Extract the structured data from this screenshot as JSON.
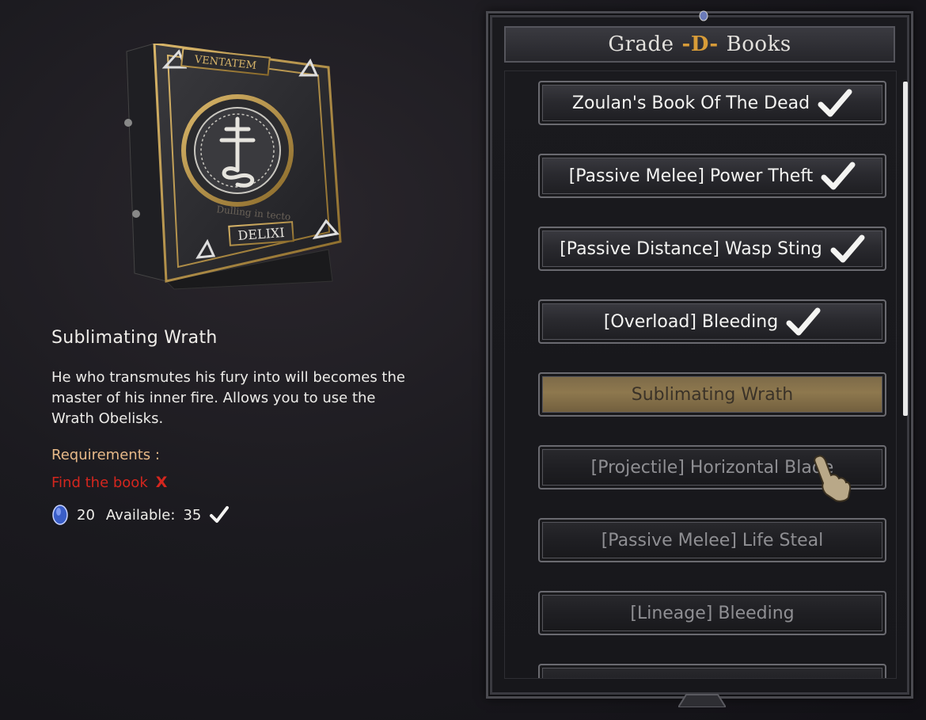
{
  "detail": {
    "title": "Sublimating Wrath",
    "description": "He who transmutes his fury into will becomes the master of his inner fire. Allows you to use the Wrath Obelisks.",
    "requirements_label": "Requirements :",
    "find_book": "Find the book",
    "find_book_status": "X",
    "cost": "20",
    "available_label": "Available:",
    "available": "35"
  },
  "book_art": {
    "top_label": "VENTATEM",
    "bottom_label": "DELIXI",
    "middle_label": "Dulling in tecto"
  },
  "panel": {
    "title_left": "Grade",
    "grade": "-D-",
    "title_right": "Books",
    "items": [
      {
        "label": "Zoulan's Book Of The Dead",
        "state": "learned"
      },
      {
        "label": "[Passive Melee] Power Theft",
        "state": "learned"
      },
      {
        "label": "[Passive Distance] Wasp Sting",
        "state": "learned"
      },
      {
        "label": "[Overload] Bleeding",
        "state": "learned"
      },
      {
        "label": "Sublimating Wrath",
        "state": "selected"
      },
      {
        "label": "[Projectile] Horizontal Blade",
        "state": "locked"
      },
      {
        "label": "[Passive Melee] Life Steal",
        "state": "locked"
      },
      {
        "label": "[Lineage] Bleeding",
        "state": "locked"
      }
    ]
  },
  "colors": {
    "accent_gold": "#d89c38",
    "requirement_label": "#e7b988",
    "missing_red": "#d4261e",
    "selected_button": "#8e784e"
  }
}
